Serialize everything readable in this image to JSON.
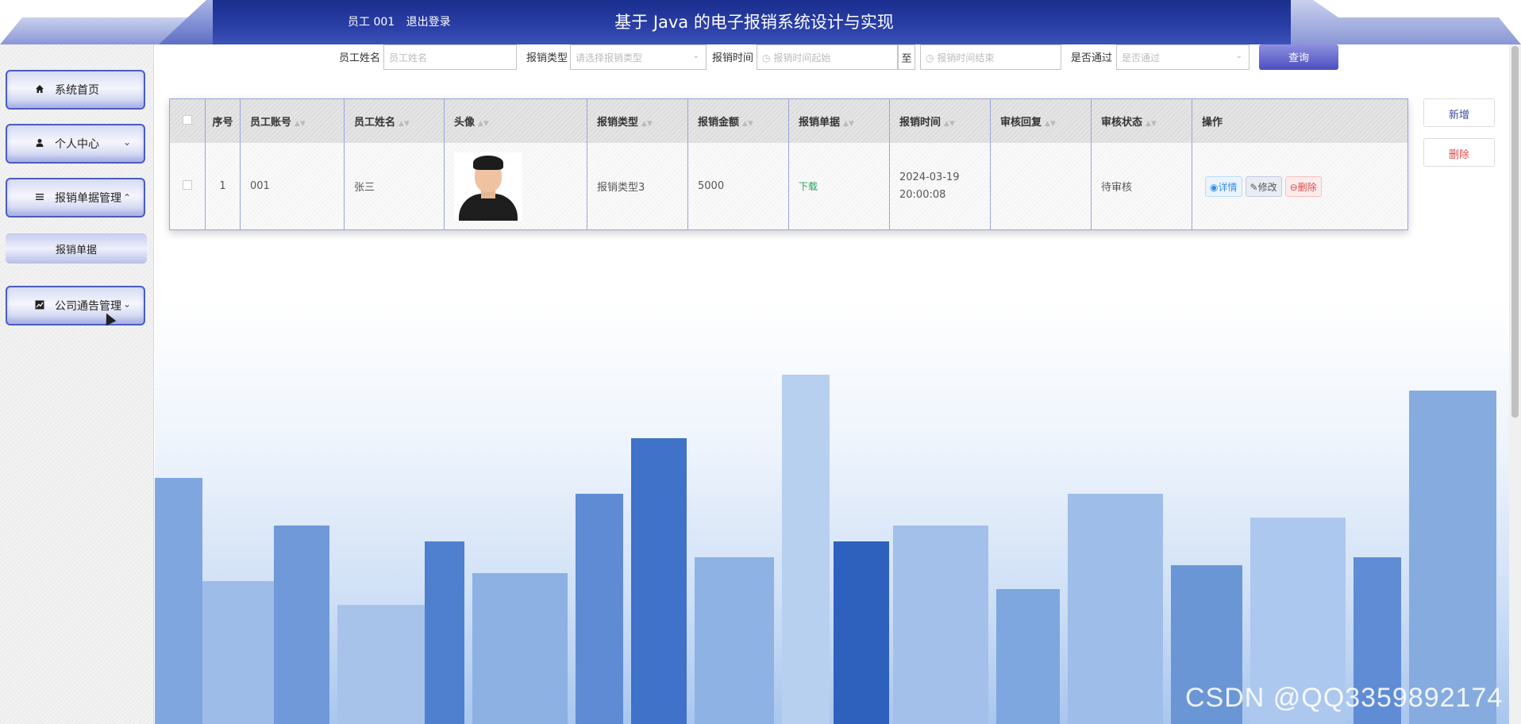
{
  "header": {
    "user": "员工 001",
    "logout": "退出登录",
    "title": "基于 Java 的电子报销系统设计与实现"
  },
  "sidebar": {
    "items": [
      {
        "label": "系统首页",
        "icon": "home-icon"
      },
      {
        "label": "个人中心",
        "icon": "user-icon"
      },
      {
        "label": "报销单据管理",
        "icon": "list-icon"
      },
      {
        "label": "公司通告管理",
        "icon": "chart-icon"
      }
    ],
    "sub_item": "报销单据"
  },
  "search": {
    "name_label": "员工姓名",
    "name_placeholder": "员工姓名",
    "type_label": "报销类型",
    "type_placeholder": "请选择报销类型",
    "time_label": "报销时间",
    "time_start_placeholder": "报销时间起始",
    "to_label": "至",
    "time_end_placeholder": "报销时间结束",
    "pass_label": "是否通过",
    "pass_placeholder": "是否通过",
    "query_button": "查询"
  },
  "actions": {
    "add": "新增",
    "delete": "删除"
  },
  "table": {
    "headers": [
      "序号",
      "员工账号",
      "员工姓名",
      "头像",
      "报销类型",
      "报销金额",
      "报销单据",
      "报销时间",
      "审核回复",
      "审核状态",
      "操作"
    ],
    "rows": [
      {
        "index": "1",
        "account": "001",
        "name": "张三",
        "type": "报销类型3",
        "amount": "5000",
        "document": "下载",
        "time": "2024-03-19 20:00:08",
        "reply": "",
        "status": "待审核",
        "op_detail": "详情",
        "op_edit": "修改",
        "op_delete": "删除"
      }
    ]
  },
  "watermark": "CSDN @QQ3359892174"
}
